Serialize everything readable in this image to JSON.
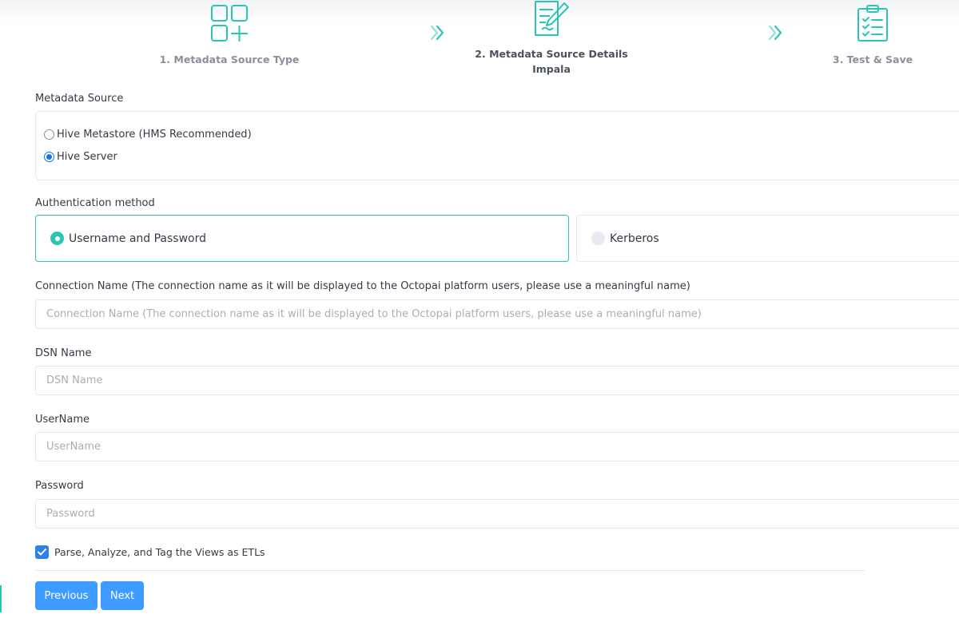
{
  "steps": [
    {
      "label": "1. Metadata Source Type",
      "icon": "grid-plus-icon"
    },
    {
      "label": "2. Metadata Source Details",
      "sublabel": "Impala",
      "icon": "edit-document-icon"
    },
    {
      "label": "3. Test & Save",
      "icon": "clipboard-checklist-icon"
    }
  ],
  "metadata_source": {
    "label": "Metadata Source",
    "options": [
      {
        "label": "Hive Metastore (HMS Recommended)",
        "checked": false
      },
      {
        "label": "Hive Server",
        "checked": true
      }
    ]
  },
  "auth": {
    "label": "Authentication method",
    "options": [
      {
        "label": "Username and Password",
        "selected": true
      },
      {
        "label": "Kerberos",
        "selected": false
      }
    ]
  },
  "fields": {
    "connection_name": {
      "label": "Connection Name (The connection name as it will be displayed to the Octopai platform users, please use a meaningful name)",
      "placeholder": "Connection Name (The connection name as it will be displayed to the Octopai platform users, please use a meaningful name)",
      "value": ""
    },
    "dsn_name": {
      "label": "DSN Name",
      "placeholder": "DSN Name",
      "value": ""
    },
    "username": {
      "label": "UserName",
      "placeholder": "UserName",
      "value": ""
    },
    "password": {
      "label": "Password",
      "placeholder": "Password",
      "value": ""
    }
  },
  "parse_views": {
    "label": "Parse, Analyze, and Tag the Views as ETLs",
    "checked": true
  },
  "buttons": {
    "previous": "Previous",
    "next": "Next"
  },
  "colors": {
    "accent": "#2cc4b4",
    "button": "#3e9bff",
    "checkbox": "#2f80ed"
  }
}
